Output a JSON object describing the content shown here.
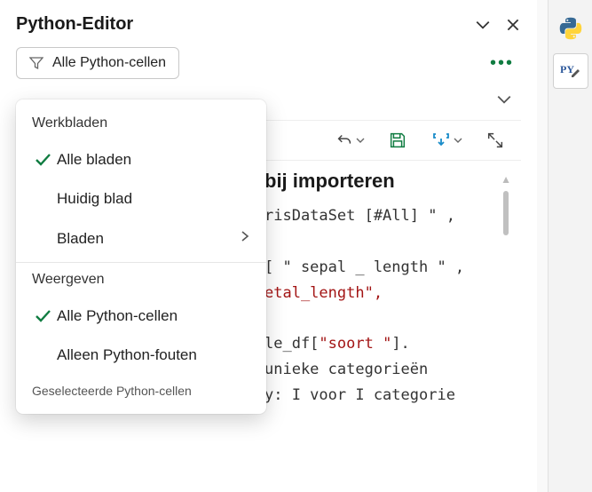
{
  "panel": {
    "title": "Python-Editor"
  },
  "filter": {
    "label": "Alle Python-cellen"
  },
  "dropdown": {
    "section1": "Werkbladen",
    "items1": [
      {
        "label": "Alle bladen",
        "checked": true,
        "hasSubmenu": false
      },
      {
        "label": "Huidig blad",
        "checked": false,
        "hasSubmenu": false
      },
      {
        "label": "Bladen",
        "checked": false,
        "hasSubmenu": true
      }
    ],
    "section2": "Weergeven",
    "items2": [
      {
        "label": "Alle Python-cellen",
        "checked": true
      },
      {
        "label": "Alleen Python-fouten",
        "checked": false
      }
    ],
    "footer": "Geselecteerde Python-cellen"
  },
  "code": {
    "heading": "bij importeren",
    "line1a": "risDataSet [#All] \" ,",
    "line2a": "[ \" sepal _ length \" ,",
    "line2b": "etal_length\",",
    "line3a": "le_df[",
    "line3b": "\"soort \"",
    "line3c": "].",
    "line4": "unieke categorieën",
    "line5": "y: I voor I categorie"
  }
}
